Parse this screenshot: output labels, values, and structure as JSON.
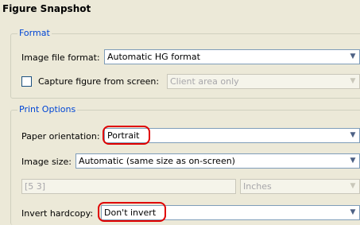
{
  "title": "Figure Snapshot",
  "format": {
    "legend": "Format",
    "image_file_format_label": "Image file format:",
    "image_file_format_value": "Automatic HG format",
    "capture_label": "Capture figure from screen:",
    "capture_value": "Client area only"
  },
  "print": {
    "legend": "Print Options",
    "orientation_label": "Paper orientation:",
    "orientation_value": "Portrait",
    "image_size_label": "Image size:",
    "image_size_value": "Automatic (same size as on-screen)",
    "dimensions_value": "[5 3]",
    "units_value": "Inches",
    "invert_label": "Invert hardcopy:",
    "invert_value": "Don't invert"
  },
  "icons": {
    "dropdown": "chevron-down-icon"
  },
  "colors": {
    "legend": "#0046d5",
    "highlight": "#e00000",
    "background": "#ece9d8"
  }
}
